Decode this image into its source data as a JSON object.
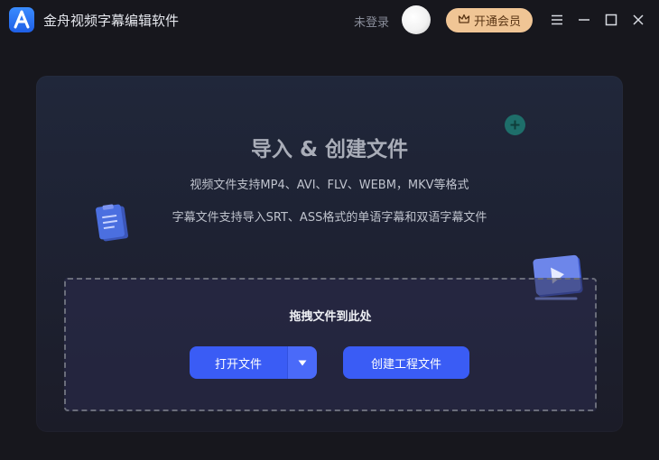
{
  "titlebar": {
    "app_title": "金舟视频字幕编辑软件",
    "login_text": "未登录",
    "vip_label": "开通会员",
    "icons": {
      "logo": "app-logo-icon",
      "menu": "menu-icon",
      "minimize": "minimize-icon",
      "maximize": "maximize-icon",
      "close": "close-icon",
      "crown": "crown-icon"
    }
  },
  "main": {
    "title": "导入 & 创建文件",
    "video_formats": "视频文件支持MP4、AVI、FLV、WEBM，MKV等格式",
    "subtitle_formats": "字幕文件支持导入SRT、ASS格式的单语字幕和双语字幕文件",
    "drop_text": "拖拽文件到此处",
    "open_label": "打开文件",
    "create_label": "创建工程文件"
  },
  "colors": {
    "background": "#17171d",
    "accent": "#3a5cf5",
    "vip": "#f0c595"
  }
}
